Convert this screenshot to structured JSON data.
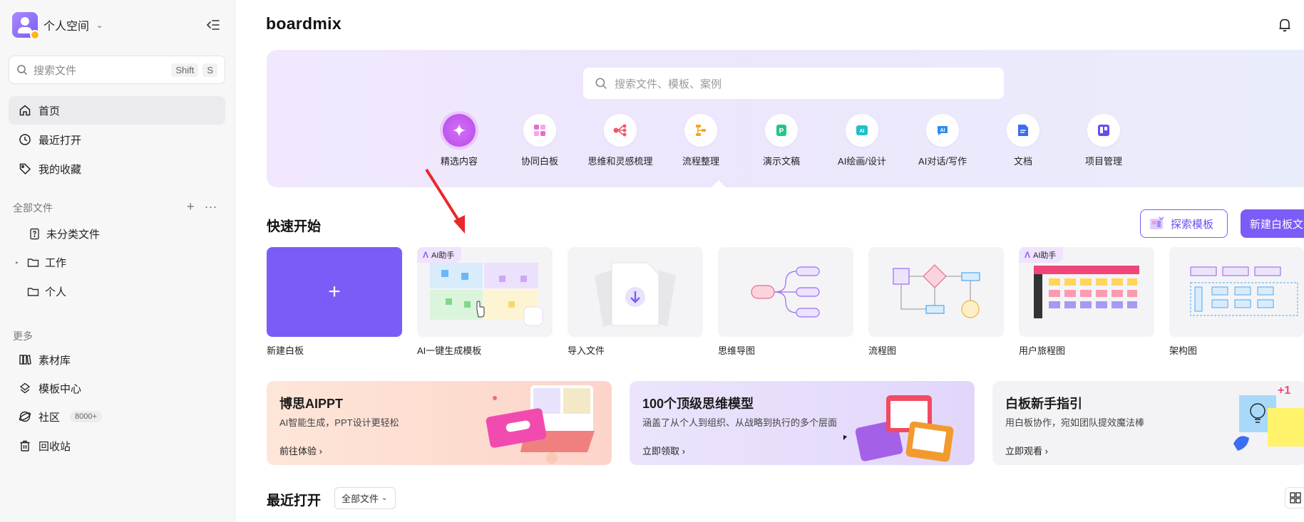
{
  "sidebar": {
    "workspace_name": "个人空间",
    "search_placeholder": "搜索文件",
    "shortcut_keys": [
      "Shift",
      "S"
    ],
    "nav": [
      "首页",
      "最近打开",
      "我的收藏"
    ],
    "all_files_label": "全部文件",
    "tree": [
      "未分类文件",
      "工作",
      "个人"
    ],
    "more_label": "更多",
    "more_items": [
      "素材库",
      "模板中心",
      "社区",
      "回收站"
    ],
    "community_badge": "8000+"
  },
  "header": {
    "logo": "boardmix"
  },
  "hero": {
    "search_placeholder": "搜索文件、模板、案例",
    "categories": [
      "精选内容",
      "协同白板",
      "思维和灵感梳理",
      "流程整理",
      "演示文稿",
      "AI绘画/设计",
      "AI对话/写作",
      "文档",
      "项目管理"
    ]
  },
  "quick_start": {
    "title": "快速开始",
    "explore_label": "探索模板",
    "new_label": "新建白板文",
    "ai_tag": "AI助手",
    "cards": [
      "新建白板",
      "AI一键生成模板",
      "导入文件",
      "思维导图",
      "流程图",
      "用户旅程图",
      "架构图"
    ]
  },
  "banners": [
    {
      "title": "博思AIPPT",
      "subtitle": "AI智能生成，PPT设计更轻松",
      "link": "前往体验"
    },
    {
      "title": "100个顶级思维模型",
      "subtitle": "涵盖了从个人到组织、从战略到执行的多个层面",
      "link": "立即领取"
    },
    {
      "title": "白板新手指引",
      "subtitle": "用白板协作，宛如团队提效魔法棒",
      "link": "立即观看"
    }
  ],
  "recent": {
    "title": "最近打开",
    "filter_label": "全部文件"
  },
  "colors": {
    "accent": "#7b5cf6",
    "hero_bg": "#efe7fd"
  }
}
